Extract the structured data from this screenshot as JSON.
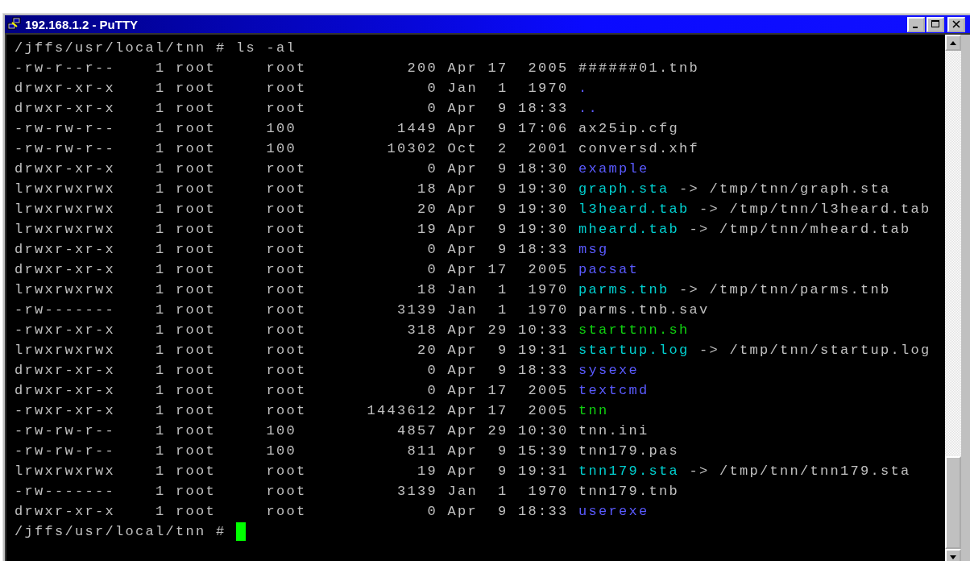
{
  "window": {
    "title": "192.168.1.2 - PuTTY"
  },
  "terminal": {
    "command_line": {
      "prompt": "/jffs/usr/local/tnn #",
      "command": "ls -al"
    },
    "entries": [
      {
        "perms": "-rw-r--r--",
        "links": "1",
        "owner": "root",
        "group": "root",
        "size": "200",
        "date": "Apr 17  2005",
        "name": "######01.tnb",
        "kind": "file"
      },
      {
        "perms": "drwxr-xr-x",
        "links": "1",
        "owner": "root",
        "group": "root",
        "size": "0",
        "date": "Jan  1  1970",
        "name": ".",
        "kind": "dir"
      },
      {
        "perms": "drwxr-xr-x",
        "links": "1",
        "owner": "root",
        "group": "root",
        "size": "0",
        "date": "Apr  9 18:33",
        "name": "..",
        "kind": "dir"
      },
      {
        "perms": "-rw-rw-r--",
        "links": "1",
        "owner": "root",
        "group": "100",
        "size": "1449",
        "date": "Apr  9 17:06",
        "name": "ax25ip.cfg",
        "kind": "file"
      },
      {
        "perms": "-rw-rw-r--",
        "links": "1",
        "owner": "root",
        "group": "100",
        "size": "10302",
        "date": "Oct  2  2001",
        "name": "conversd.xhf",
        "kind": "file"
      },
      {
        "perms": "drwxr-xr-x",
        "links": "1",
        "owner": "root",
        "group": "root",
        "size": "0",
        "date": "Apr  9 18:30",
        "name": "example",
        "kind": "dir"
      },
      {
        "perms": "lrwxrwxrwx",
        "links": "1",
        "owner": "root",
        "group": "root",
        "size": "18",
        "date": "Apr  9 19:30",
        "name": "graph.sta",
        "kind": "link",
        "arrow": "->",
        "target": "/tmp/tnn/graph.sta"
      },
      {
        "perms": "lrwxrwxrwx",
        "links": "1",
        "owner": "root",
        "group": "root",
        "size": "20",
        "date": "Apr  9 19:30",
        "name": "l3heard.tab",
        "kind": "link",
        "arrow": "->",
        "target": "/tmp/tnn/l3heard.tab"
      },
      {
        "perms": "lrwxrwxrwx",
        "links": "1",
        "owner": "root",
        "group": "root",
        "size": "19",
        "date": "Apr  9 19:30",
        "name": "mheard.tab",
        "kind": "link",
        "arrow": "->",
        "target": "/tmp/tnn/mheard.tab"
      },
      {
        "perms": "drwxr-xr-x",
        "links": "1",
        "owner": "root",
        "group": "root",
        "size": "0",
        "date": "Apr  9 18:33",
        "name": "msg",
        "kind": "dir"
      },
      {
        "perms": "drwxr-xr-x",
        "links": "1",
        "owner": "root",
        "group": "root",
        "size": "0",
        "date": "Apr 17  2005",
        "name": "pacsat",
        "kind": "dir"
      },
      {
        "perms": "lrwxrwxrwx",
        "links": "1",
        "owner": "root",
        "group": "root",
        "size": "18",
        "date": "Jan  1  1970",
        "name": "parms.tnb",
        "kind": "link",
        "arrow": "->",
        "target": "/tmp/tnn/parms.tnb"
      },
      {
        "perms": "-rw-------",
        "links": "1",
        "owner": "root",
        "group": "root",
        "size": "3139",
        "date": "Jan  1  1970",
        "name": "parms.tnb.sav",
        "kind": "file"
      },
      {
        "perms": "-rwxr-xr-x",
        "links": "1",
        "owner": "root",
        "group": "root",
        "size": "318",
        "date": "Apr 29 10:33",
        "name": "starttnn.sh",
        "kind": "exec"
      },
      {
        "perms": "lrwxrwxrwx",
        "links": "1",
        "owner": "root",
        "group": "root",
        "size": "20",
        "date": "Apr  9 19:31",
        "name": "startup.log",
        "kind": "link",
        "arrow": "->",
        "target": "/tmp/tnn/startup.log"
      },
      {
        "perms": "drwxr-xr-x",
        "links": "1",
        "owner": "root",
        "group": "root",
        "size": "0",
        "date": "Apr  9 18:33",
        "name": "sysexe",
        "kind": "dir"
      },
      {
        "perms": "drwxr-xr-x",
        "links": "1",
        "owner": "root",
        "group": "root",
        "size": "0",
        "date": "Apr 17  2005",
        "name": "textcmd",
        "kind": "dir"
      },
      {
        "perms": "-rwxr-xr-x",
        "links": "1",
        "owner": "root",
        "group": "root",
        "size": "1443612",
        "date": "Apr 17  2005",
        "name": "tnn",
        "kind": "exec"
      },
      {
        "perms": "-rw-rw-r--",
        "links": "1",
        "owner": "root",
        "group": "100",
        "size": "4857",
        "date": "Apr 29 10:30",
        "name": "tnn.ini",
        "kind": "file"
      },
      {
        "perms": "-rw-rw-r--",
        "links": "1",
        "owner": "root",
        "group": "100",
        "size": "811",
        "date": "Apr  9 15:39",
        "name": "tnn179.pas",
        "kind": "file"
      },
      {
        "perms": "lrwxrwxrwx",
        "links": "1",
        "owner": "root",
        "group": "root",
        "size": "19",
        "date": "Apr  9 19:31",
        "name": "tnn179.sta",
        "kind": "link",
        "arrow": "->",
        "target": "/tmp/tnn/tnn179.sta"
      },
      {
        "perms": "-rw-------",
        "links": "1",
        "owner": "root",
        "group": "root",
        "size": "3139",
        "date": "Jan  1  1970",
        "name": "tnn179.tnb",
        "kind": "file"
      },
      {
        "perms": "drwxr-xr-x",
        "links": "1",
        "owner": "root",
        "group": "root",
        "size": "0",
        "date": "Apr  9 18:33",
        "name": "userexe",
        "kind": "dir"
      }
    ],
    "prompt_line": {
      "prompt": "/jffs/usr/local/tnn #"
    }
  }
}
